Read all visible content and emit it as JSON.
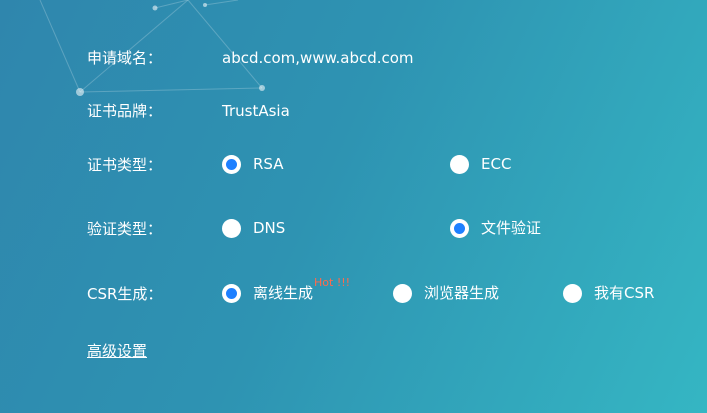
{
  "form": {
    "domain": {
      "label": "申请域名：",
      "value": "abcd.com,www.abcd.com"
    },
    "brand": {
      "label": "证书品牌：",
      "value": "TrustAsia"
    },
    "cert_type": {
      "label": "证书类型：",
      "options": [
        {
          "label": "RSA",
          "checked": true
        },
        {
          "label": "ECC",
          "checked": false
        }
      ]
    },
    "verify_type": {
      "label": "验证类型：",
      "options": [
        {
          "label": "DNS",
          "checked": false
        },
        {
          "label": "文件验证",
          "checked": true
        }
      ]
    },
    "csr": {
      "label": "CSR生成：",
      "options": [
        {
          "label": "离线生成",
          "badge": "Hot !!!",
          "checked": true
        },
        {
          "label": "浏览器生成",
          "checked": false
        },
        {
          "label": "我有CSR",
          "checked": false
        }
      ]
    },
    "advanced_link": "高级设置"
  },
  "colors": {
    "radio_checked": "#1e80ff",
    "hot_badge": "#ff6a4b",
    "background_start": "#2f86ad",
    "background_end": "#35b6c3"
  }
}
